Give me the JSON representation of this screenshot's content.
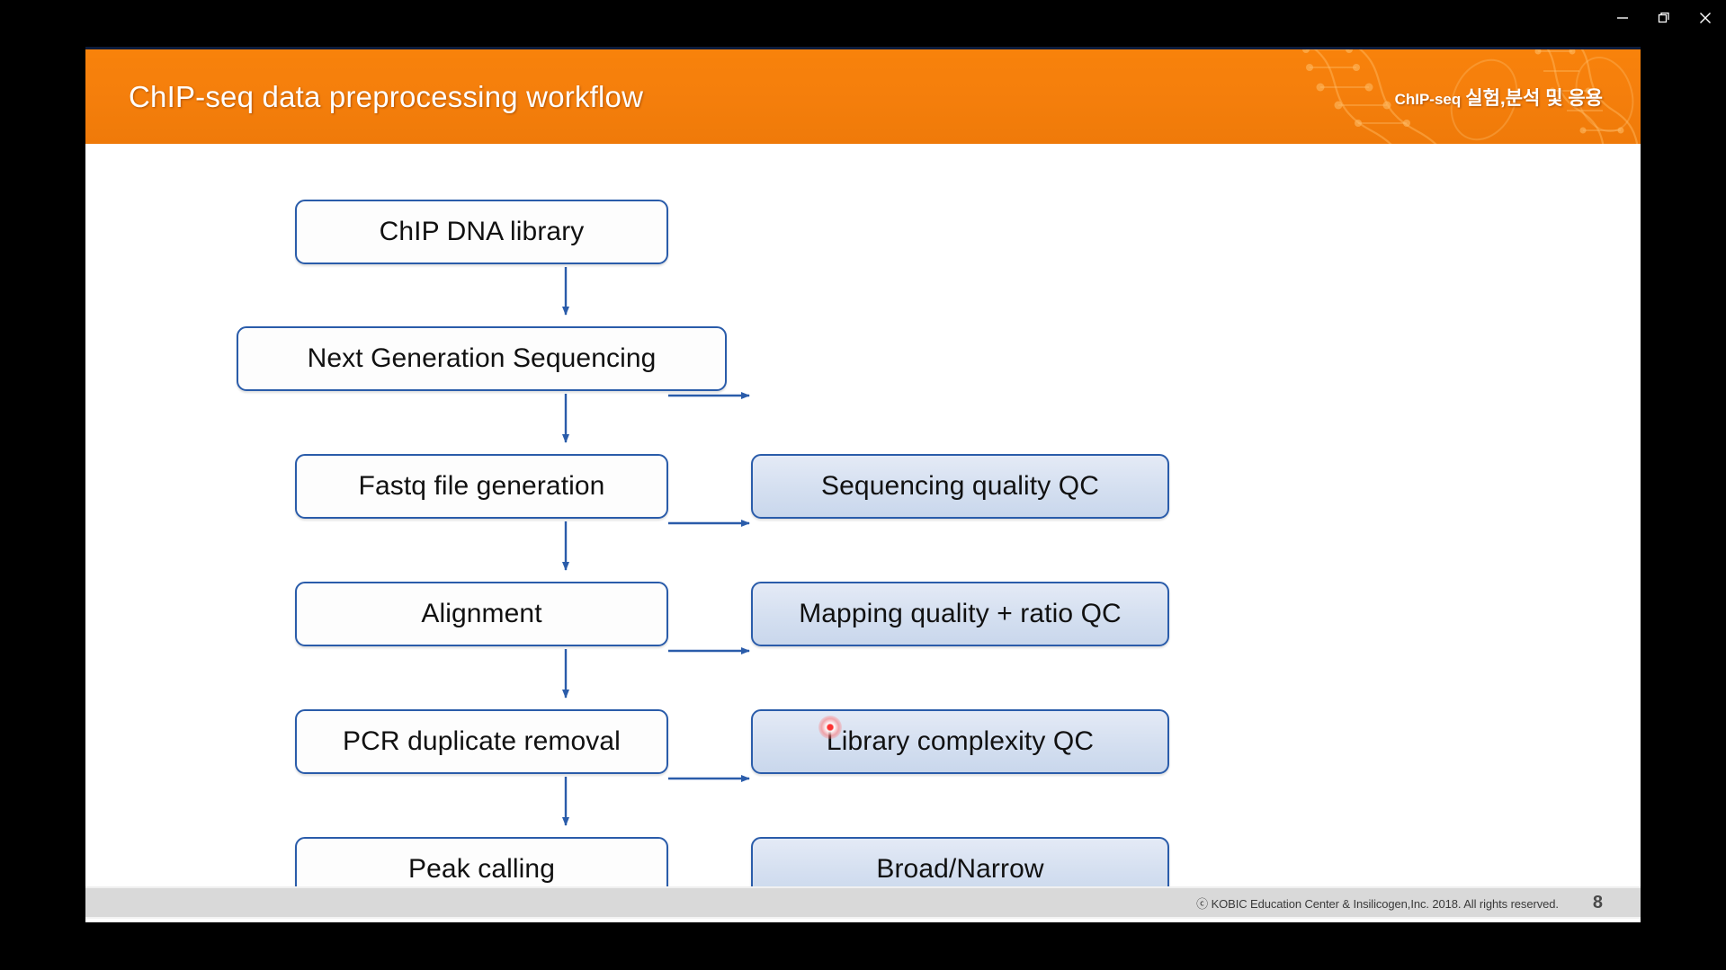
{
  "window": {
    "controls": [
      {
        "name": "minimize",
        "glyph": "minimize-icon"
      },
      {
        "name": "restore",
        "glyph": "restore-icon"
      },
      {
        "name": "close",
        "glyph": "close-icon"
      }
    ]
  },
  "slide": {
    "title": "ChIP-seq data preprocessing workflow",
    "brand_en": "ChIP-seq",
    "brand_ko": "실험,분석 및 응용",
    "header_color": "#f5800b",
    "accent_border": "#2a5caa",
    "qc_fill": "#d4dff0",
    "footer": {
      "copyright": "ⓒ KOBIC Education Center & Insilicogen,Inc. 2018. All rights reserved.",
      "page_number": "8"
    }
  },
  "diagram": {
    "flow_steps": [
      {
        "id": "chip-dna-library",
        "label": "ChIP DNA library"
      },
      {
        "id": "next-gen-sequencing",
        "label": "Next Generation Sequencing"
      },
      {
        "id": "fastq-file-generation",
        "label": "Fastq file generation"
      },
      {
        "id": "alignment",
        "label": "Alignment"
      },
      {
        "id": "pcr-duplicate-removal",
        "label": "PCR duplicate removal"
      },
      {
        "id": "peak-calling",
        "label": "Peak calling"
      }
    ],
    "qc_steps": [
      {
        "id": "sequencing-quality-qc",
        "label": "Sequencing quality QC"
      },
      {
        "id": "mapping-quality-ratio-qc",
        "label": "Mapping quality + ratio  QC"
      },
      {
        "id": "library-complexity-qc",
        "label": "Library complexity QC"
      },
      {
        "id": "broad-narrow",
        "label": "Broad/Narrow"
      }
    ]
  }
}
